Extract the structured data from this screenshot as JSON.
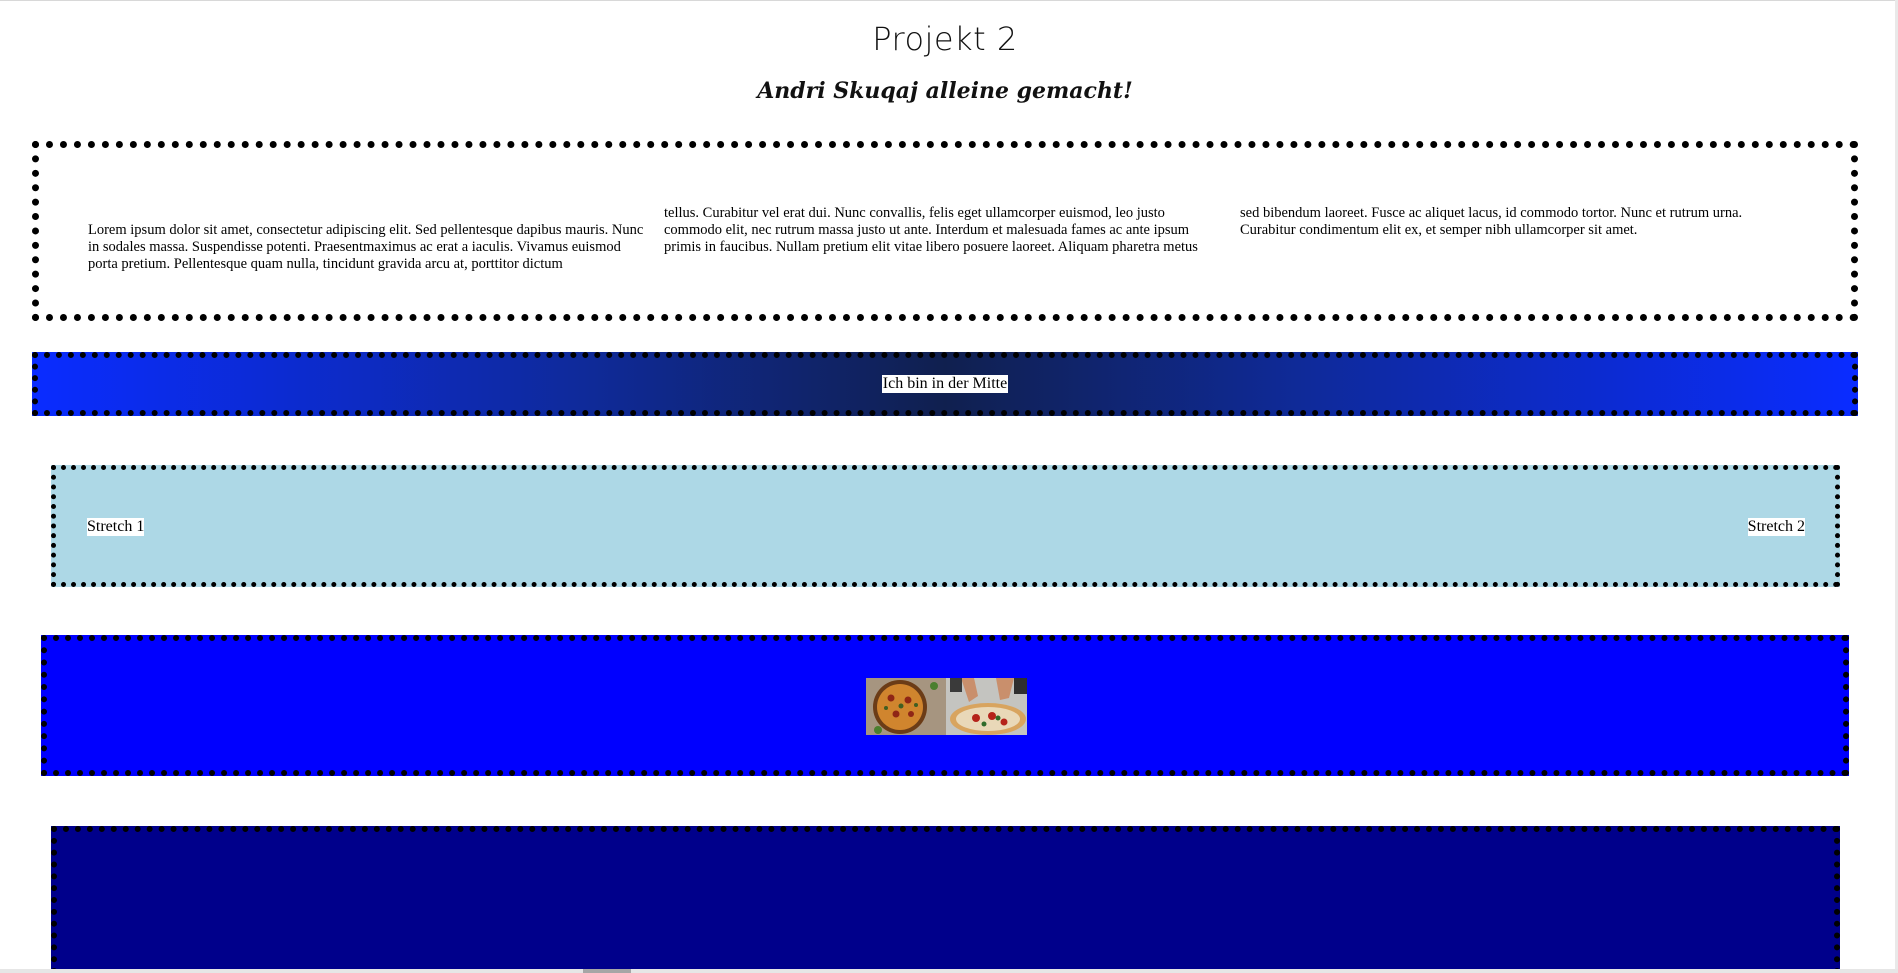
{
  "header": {
    "title": "Projekt 2",
    "subtitle": "Andri Skuqaj alleine gemacht!"
  },
  "text_columns": [
    "Lorem ipsum dolor sit amet, consectetur adipiscing elit. Sed pellentesque dapibus mauris. Nunc in sodales massa. Suspendisse potenti. Praesentmaximus ac erat a iaculis. Vivamus euismod porta pretium. Pellentesque quam nulla, tincidunt gravida arcu at, porttitor dictum",
    "tellus. Curabitur vel erat dui. Nunc convallis, felis eget ullamcorper euismod, leo justo commodo elit, nec rutrum massa justo ut ante. Interdum et malesuada fames ac ante ipsum primis in faucibus. Nullam pretium elit vitae libero posuere laoreet. Aliquam pharetra metus",
    "sed bibendum laoreet. Fusce ac aliquet lacus, id commodo tortor. Nunc et rutrum urna. Curabitur condimentum elit ex, et semper nibh ullamcorper sit amet."
  ],
  "center_box": {
    "label": "Ich bin in der Mitte"
  },
  "stretch_box": {
    "left_label": "Stretch 1",
    "right_label": "Stretch 2",
    "background": "#add8e6"
  },
  "image_box": {
    "background": "#0000ff",
    "image_subject": "pizza-photo"
  },
  "dark_box": {
    "background": "#00008b"
  }
}
